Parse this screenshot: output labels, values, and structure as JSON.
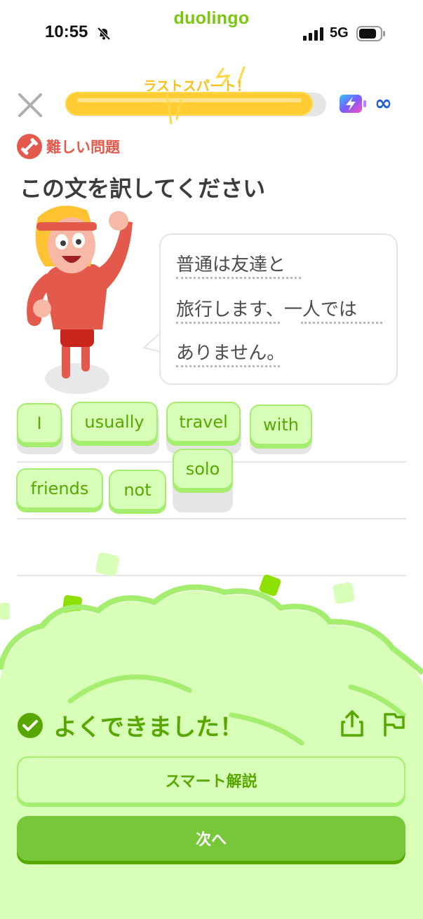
{
  "status_bar": {
    "time": "10:55",
    "brand": "duolingo",
    "network": "5G"
  },
  "header": {
    "progress_label": "ラストスパート！",
    "progress": 0.97,
    "energy": "∞"
  },
  "badge": {
    "label": "難しい問題"
  },
  "prompt": {
    "title": "この文を訳してください"
  },
  "speech": {
    "lines": [
      "普通は友達と",
      "旅行します、一人では",
      "ありません。"
    ]
  },
  "answer_words": [
    "I",
    "usually",
    "travel",
    "with",
    "friends",
    "not",
    "solo"
  ],
  "feedback": {
    "title": "よくできました！",
    "explain_button": "スマート解説",
    "next_button": "次へ"
  },
  "colors": {
    "green": "#58a700",
    "light_green": "#d7ffb8",
    "button_green": "#77c73a",
    "hard_red": "#e35a4d",
    "progress_yellow": "#ffcc33"
  },
  "icons": [
    "bell-slash-icon",
    "signal-icon",
    "battery-icon",
    "close-icon",
    "energy-battery-icon",
    "infinity-icon",
    "dumbbell-icon",
    "check-circle-icon",
    "share-icon",
    "flag-icon"
  ]
}
